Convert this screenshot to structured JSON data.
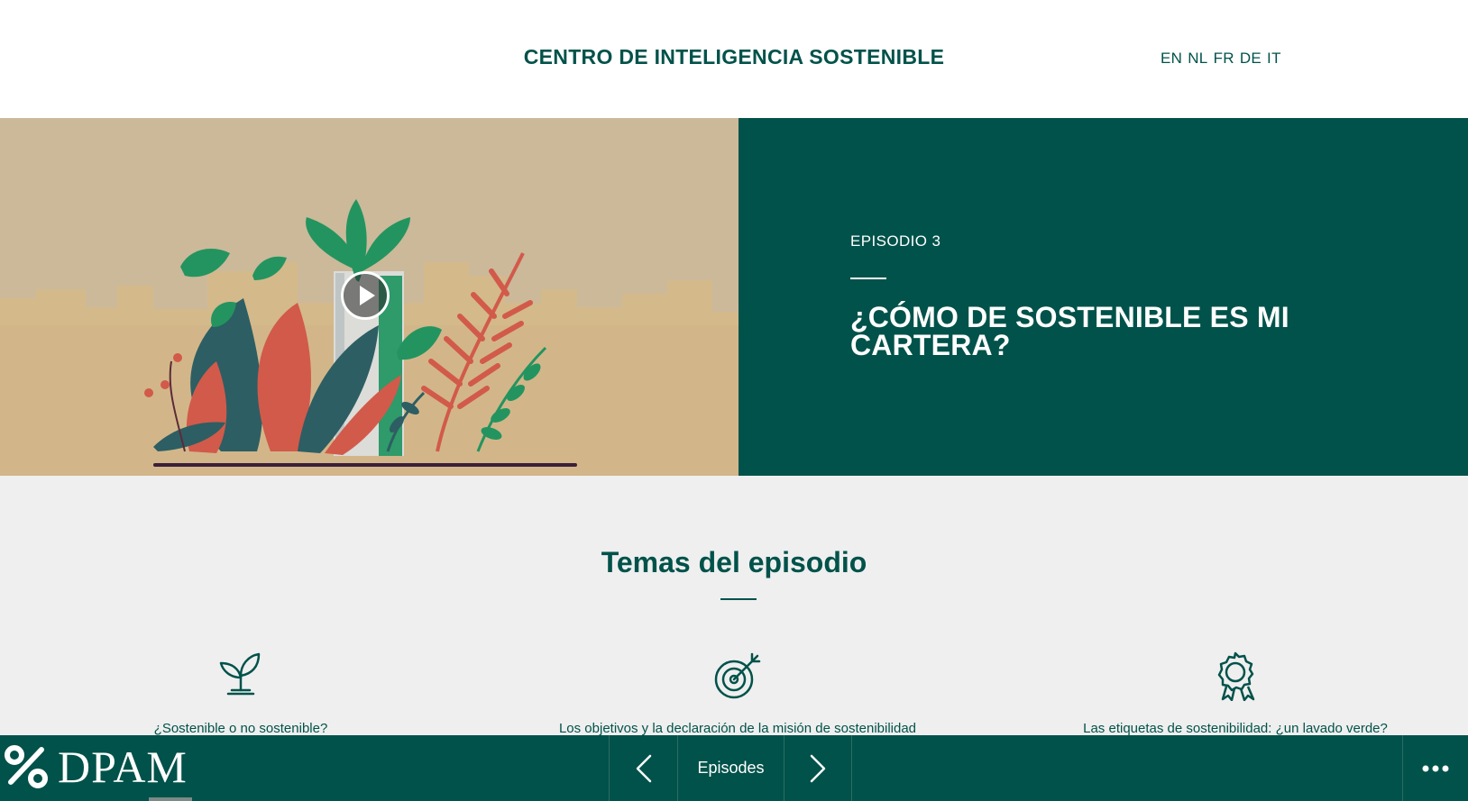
{
  "header": {
    "site_title": "CENTRO DE INTELIGENCIA SOSTENIBLE",
    "languages": [
      "EN",
      "NL",
      "FR",
      "DE",
      "IT"
    ]
  },
  "hero": {
    "episode_label": "EPISODIO 3",
    "episode_title": "¿CÓMO DE SOSTENIBLE ES MI CARTERA?",
    "play_icon": "play-icon"
  },
  "topics": {
    "heading": "Temas del episodio",
    "items": [
      {
        "icon": "sprout-icon",
        "label": "¿Sostenible o no sostenible?"
      },
      {
        "icon": "target-icon",
        "label": "Los objetivos y la declaración de la misión de sostenibilidad"
      },
      {
        "icon": "award-ribbon-icon",
        "label": "Las etiquetas de sostenibilidad: ¿un lavado verde?"
      }
    ]
  },
  "bottombar": {
    "logo_text": "DPAM",
    "episodes_label": "Episodes",
    "prev_icon": "chevron-left-icon",
    "next_icon": "chevron-right-icon",
    "more_icon": "more-dots-icon"
  },
  "colors": {
    "brand_green": "#00524a",
    "hero_media_bg": "#cbb99a",
    "topics_bg": "#efefef"
  }
}
